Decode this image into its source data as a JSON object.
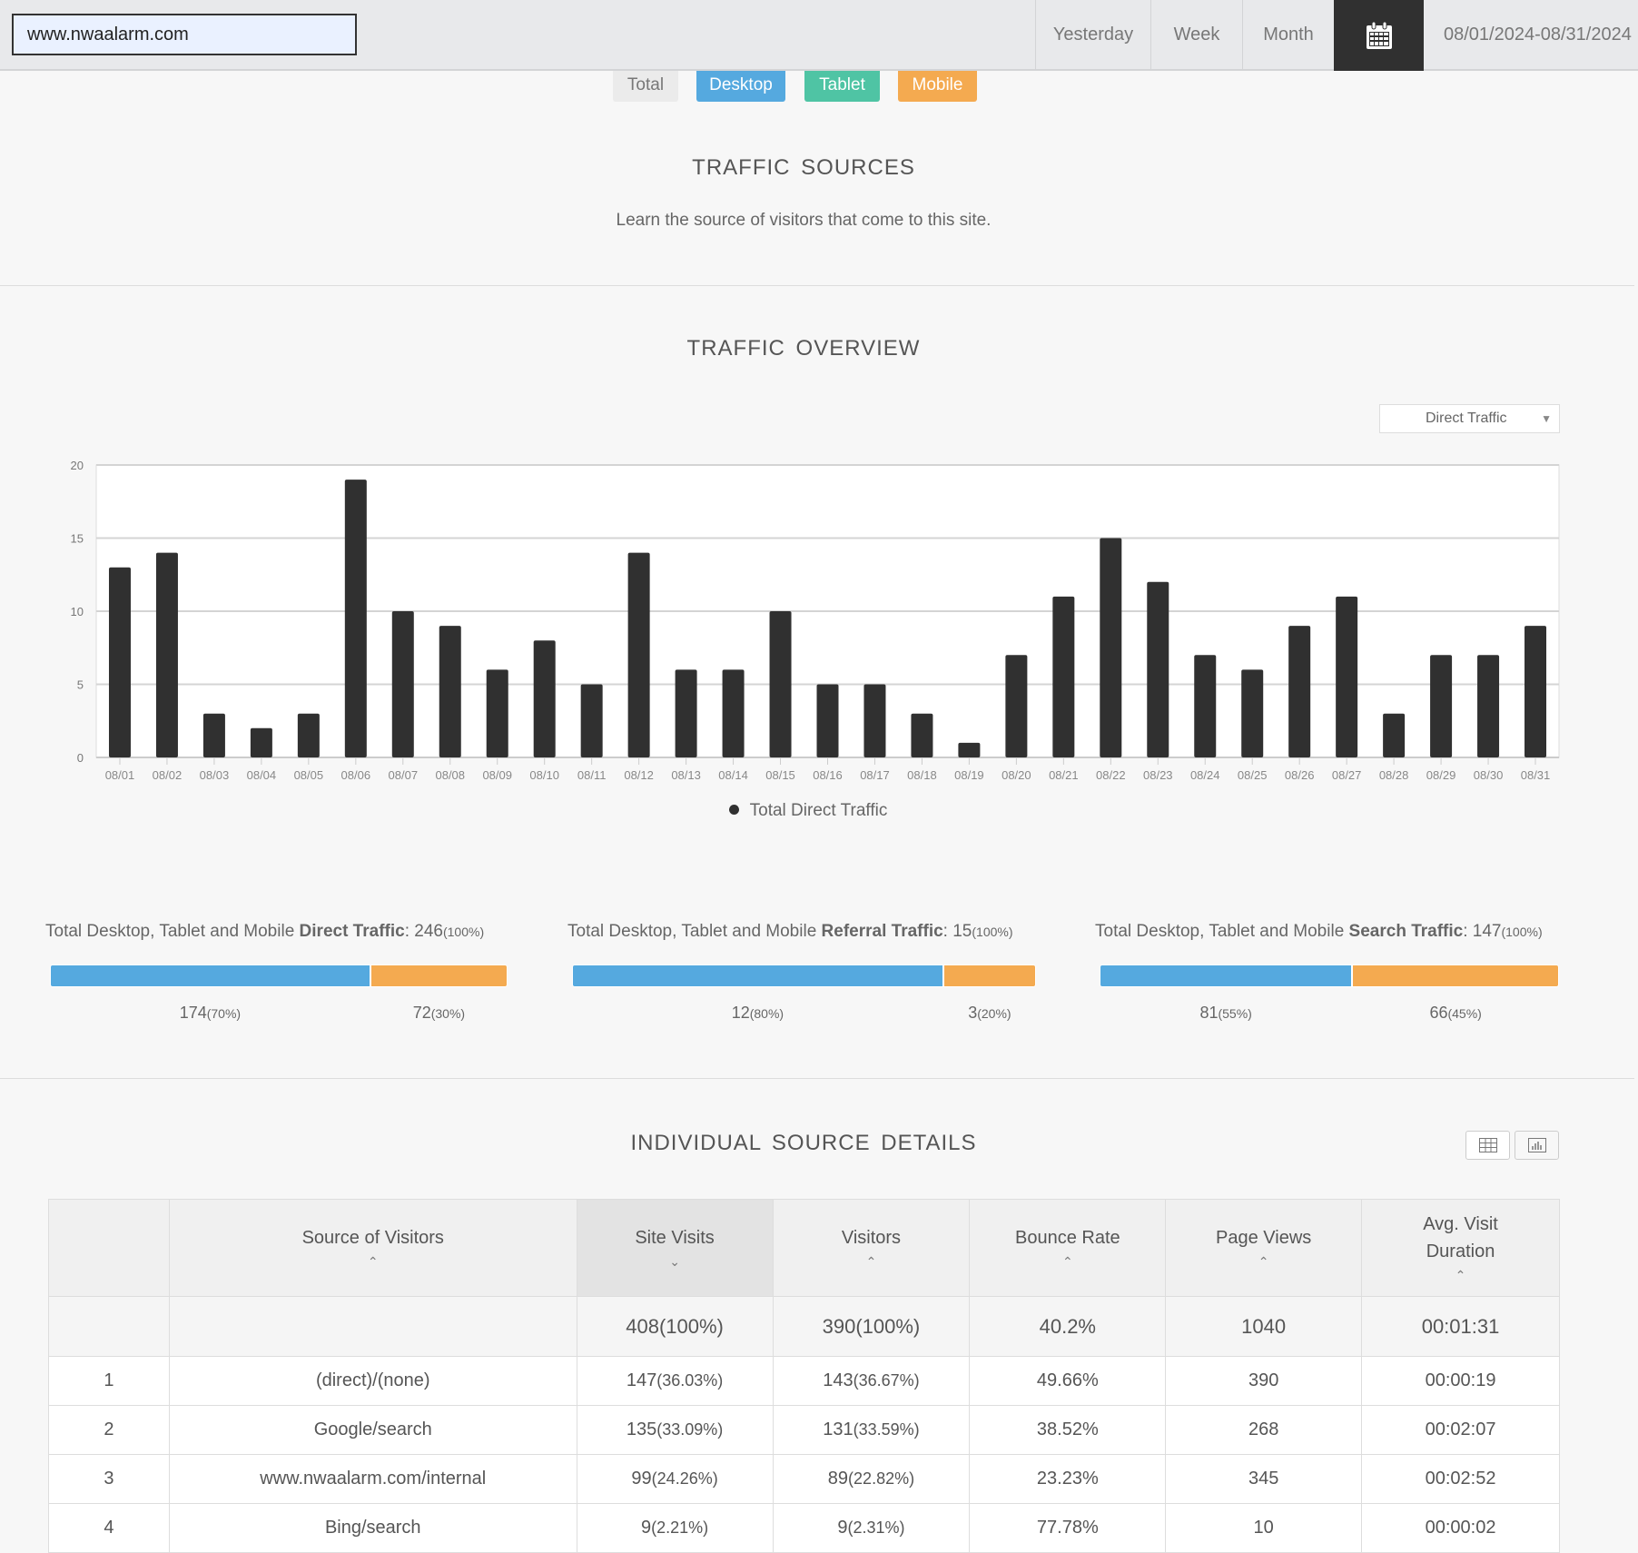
{
  "header": {
    "url": "www.nwaalarm.com",
    "nav": [
      "Yesterday",
      "Week",
      "Month"
    ],
    "calendar_icon": "calendar-icon",
    "date_range": "08/01/2024-08/31/2024"
  },
  "device_tabs": [
    {
      "label": "Total",
      "color": "#ebebeb"
    },
    {
      "label": "Desktop",
      "color": "#55a9df"
    },
    {
      "label": "Tablet",
      "color": "#4fc4a4"
    },
    {
      "label": "Mobile",
      "color": "#f4aa50"
    }
  ],
  "traffic_sources": {
    "title": "TRAFFIC SOURCES",
    "subtitle": "Learn the source of visitors that come to this site."
  },
  "overview": {
    "title": "TRAFFIC OVERVIEW",
    "dropdown": "Direct Traffic"
  },
  "chart_data": {
    "type": "bar",
    "categories": [
      "08/01",
      "08/02",
      "08/03",
      "08/04",
      "08/05",
      "08/06",
      "08/07",
      "08/08",
      "08/09",
      "08/10",
      "08/11",
      "08/12",
      "08/13",
      "08/14",
      "08/15",
      "08/16",
      "08/17",
      "08/18",
      "08/19",
      "08/20",
      "08/21",
      "08/22",
      "08/23",
      "08/24",
      "08/25",
      "08/26",
      "08/27",
      "08/28",
      "08/29",
      "08/30",
      "08/31"
    ],
    "series": [
      {
        "name": "Total Direct Traffic",
        "values": [
          13,
          14,
          3,
          2,
          3,
          19,
          10,
          9,
          6,
          8,
          5,
          14,
          6,
          6,
          10,
          5,
          5,
          3,
          1,
          7,
          11,
          15,
          12,
          7,
          6,
          9,
          11,
          3,
          7,
          7,
          9
        ],
        "color": "#303030"
      }
    ],
    "yticks": [
      "0",
      "5",
      "10",
      "15",
      "20"
    ],
    "ylim": [
      0,
      20
    ],
    "grid": true,
    "legend": "bottom"
  },
  "summaries": [
    {
      "prefix": "Total Desktop, Tablet and Mobile ",
      "bold": "Direct Traffic",
      "total": ": 246",
      "pct": "(100%)",
      "desktop": "174",
      "desktop_pct": "(70%)",
      "mobile": "72",
      "mobile_pct": "(30%)",
      "desktop_share": 70
    },
    {
      "prefix": "Total Desktop, Tablet and Mobile ",
      "bold": "Referral Traffic",
      "total": ": 15",
      "pct": "(100%)",
      "desktop": "12",
      "desktop_pct": "(80%)",
      "mobile": "3",
      "mobile_pct": "(20%)",
      "desktop_share": 80
    },
    {
      "prefix": "Total Desktop, Tablet and Mobile ",
      "bold": "Search Traffic",
      "total": ": 147",
      "pct": "(100%)",
      "desktop": "81",
      "desktop_pct": "(55%)",
      "mobile": "66",
      "mobile_pct": "(45%)",
      "desktop_share": 55
    }
  ],
  "details": {
    "title": "INDIVIDUAL SOURCE DETAILS",
    "columns": [
      "",
      "Source of Visitors",
      "Site Visits",
      "Visitors",
      "Bounce Rate",
      "Page Views",
      "Avg. Visit Duration"
    ],
    "totals": [
      "",
      "",
      "408(100%)",
      "390(100%)",
      "40.2%",
      "1040",
      "00:01:31"
    ],
    "rows": [
      {
        "n": "1",
        "source": "(direct)/(none)",
        "visits": "147",
        "visits_pct": "(36.03%)",
        "visitors": "143",
        "visitors_pct": "(36.67%)",
        "bounce": "49.66%",
        "views": "390",
        "duration": "00:00:19"
      },
      {
        "n": "2",
        "source": "Google/search",
        "visits": "135",
        "visits_pct": "(33.09%)",
        "visitors": "131",
        "visitors_pct": "(33.59%)",
        "bounce": "38.52%",
        "views": "268",
        "duration": "00:02:07"
      },
      {
        "n": "3",
        "source": "www.nwaalarm.com/internal",
        "visits": "99",
        "visits_pct": "(24.26%)",
        "visitors": "89",
        "visitors_pct": "(22.82%)",
        "bounce": "23.23%",
        "views": "345",
        "duration": "00:02:52"
      },
      {
        "n": "4",
        "source": "Bing/search",
        "visits": "9",
        "visits_pct": "(2.21%)",
        "visitors": "9",
        "visitors_pct": "(2.31%)",
        "bounce": "77.78%",
        "views": "10",
        "duration": "00:00:02"
      }
    ]
  }
}
